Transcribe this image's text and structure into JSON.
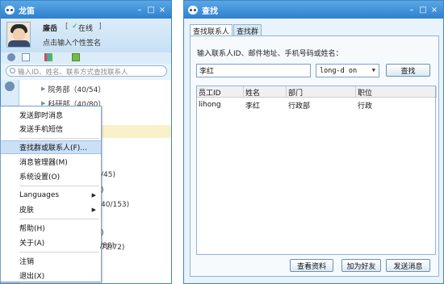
{
  "main_window": {
    "title": "龙笛",
    "controls": {
      "minimize": "–",
      "maximize": "□",
      "close": "×"
    },
    "profile": {
      "name": "廉岳",
      "status_open": "[",
      "status_check": "✓",
      "status": "在线",
      "status_close": "]",
      "signature": "点击输入个性签名"
    },
    "search": {
      "placeholder": "输入ID、姓名、联系方式查找联系人"
    },
    "groups": [
      {
        "arrow": "▶",
        "label": "院务部（40/54）"
      },
      {
        "arrow": "▶",
        "label": "科研部（40/80）"
      }
    ],
    "partial_texts": [
      "/45)",
      ")",
      "40/153)",
      ")",
      "72/72)"
    ],
    "partial_bottom": "/88)",
    "context_menu": {
      "items": [
        {
          "label": "发送即时消息"
        },
        {
          "label": "发送手机短信"
        },
        {
          "label": "查找群或联系人(F)...",
          "selected": true
        },
        {
          "label": "消息管理器(M)"
        },
        {
          "label": "系统设置(O)"
        },
        {
          "label": "Languages",
          "arrow": "▶"
        },
        {
          "label": "皮肤",
          "arrow": "▶"
        },
        {
          "label": "帮助(H)"
        },
        {
          "label": "关于(A)"
        },
        {
          "label": "注销"
        },
        {
          "label": "退出(X)"
        }
      ]
    }
  },
  "find_window": {
    "title": "查找",
    "controls": {
      "minimize": "–",
      "maximize": "□",
      "close": "×"
    },
    "tabs": [
      {
        "label": "查找联系人",
        "active": true
      },
      {
        "label": "查找群",
        "active": false
      }
    ],
    "instruction": "输入联系人ID、邮件地址、手机号码或姓名：",
    "keyword_value": "李红",
    "search_type": {
      "selected": "long-d on",
      "arrow": "▼"
    },
    "search_button": "查找",
    "results": {
      "columns": [
        "员工ID",
        "姓名",
        "部门",
        "职位"
      ],
      "rows": [
        [
          "lihong",
          "李红",
          "行政部",
          "行政"
        ]
      ]
    },
    "buttons": {
      "view": "查看资料",
      "add_friend": "加为好友",
      "send_message": "发送消息"
    }
  },
  "colors": {
    "title_bar": "#3a8ad8",
    "window_border": "#3f86c8",
    "menu_highlight": "#cce0f5",
    "row_highlight": "#f9f1c8"
  },
  "icons": [
    "app-icon",
    "avatar",
    "check-icon",
    "chat-icon",
    "mail-icon",
    "chart-icon",
    "addon-icon",
    "search-icon",
    "person-icon",
    "chevron-down-icon"
  ]
}
